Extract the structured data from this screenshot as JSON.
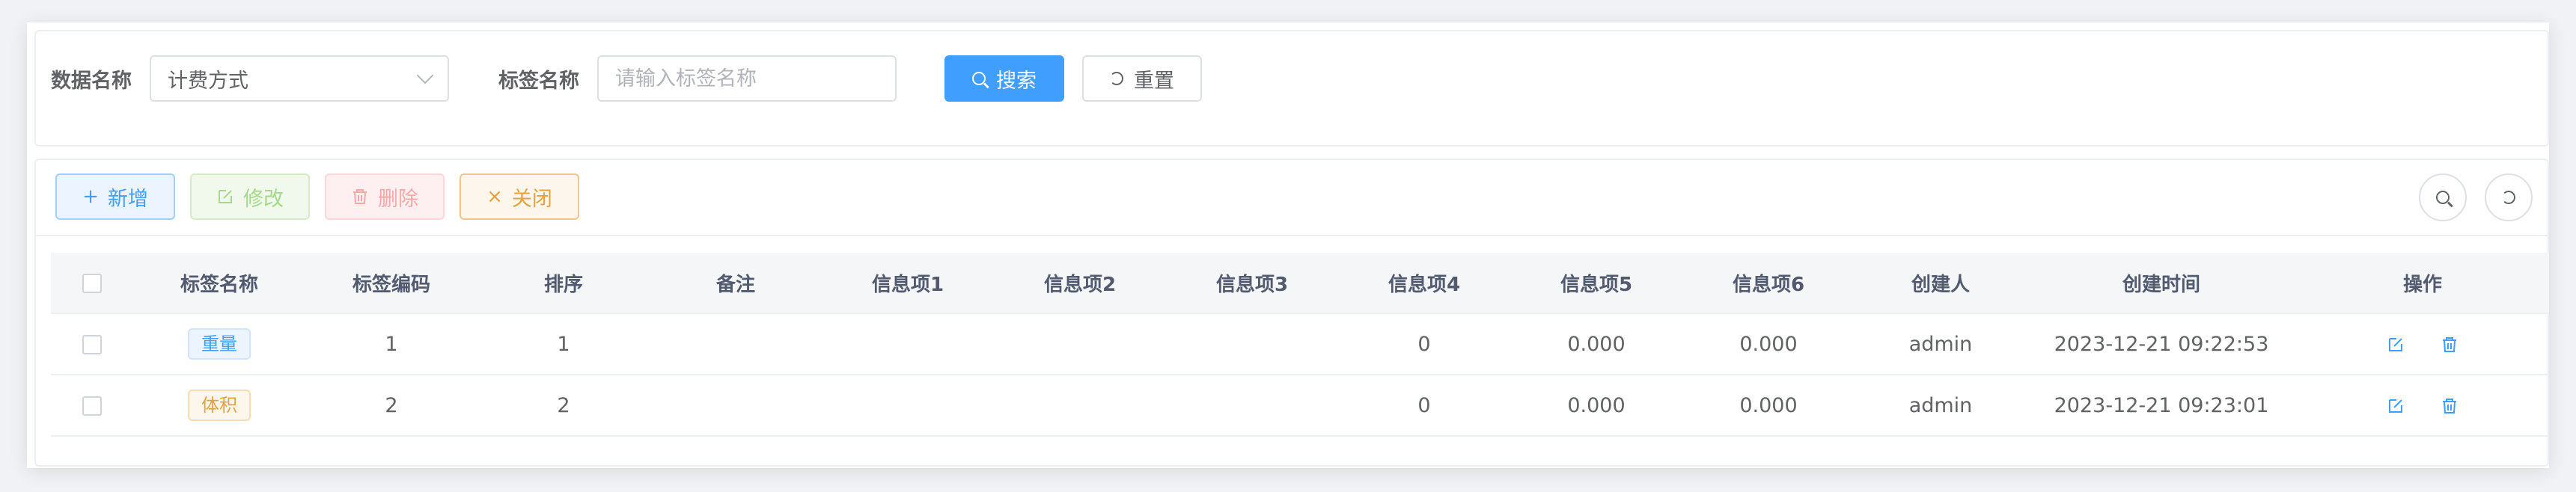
{
  "search": {
    "data_name_label": "数据名称",
    "data_name_value": "计费方式",
    "tag_name_label": "标签名称",
    "tag_name_placeholder": "请输入标签名称",
    "search_button": "搜索",
    "reset_button": "重置"
  },
  "toolbar": {
    "add": "新增",
    "edit": "修改",
    "delete": "删除",
    "close": "关闭"
  },
  "table": {
    "headers": [
      "标签名称",
      "标签编码",
      "排序",
      "备注",
      "信息项1",
      "信息项2",
      "信息项3",
      "信息项4",
      "信息项5",
      "信息项6",
      "创建人",
      "创建时间",
      "操作"
    ],
    "rows": [
      {
        "tag": "重量",
        "tag_style": "primary",
        "code": "1",
        "sort": "1",
        "remark": "",
        "info1": "",
        "info2": "",
        "info3": "",
        "info4": "0",
        "info5": "0.000",
        "info6": "0.000",
        "creator": "admin",
        "created": "2023-12-21 09:22:53"
      },
      {
        "tag": "体积",
        "tag_style": "warning",
        "code": "2",
        "sort": "2",
        "remark": "",
        "info1": "",
        "info2": "",
        "info3": "",
        "info4": "0",
        "info5": "0.000",
        "info6": "0.000",
        "creator": "admin",
        "created": "2023-12-21 09:23:01"
      }
    ]
  },
  "icons": {
    "search_button_icon": "search-icon",
    "reset_button_icon": "refresh-icon",
    "add_icon": "plus-icon",
    "edit_icon": "edit-icon",
    "delete_icon": "trash-icon",
    "close_icon": "close-icon",
    "row_edit_icon": "edit-icon",
    "row_delete_icon": "trash-icon"
  },
  "colors": {
    "primary": "#409eff",
    "success": "#67c23a",
    "danger": "#f56c6c",
    "warning": "#e6a23c"
  }
}
